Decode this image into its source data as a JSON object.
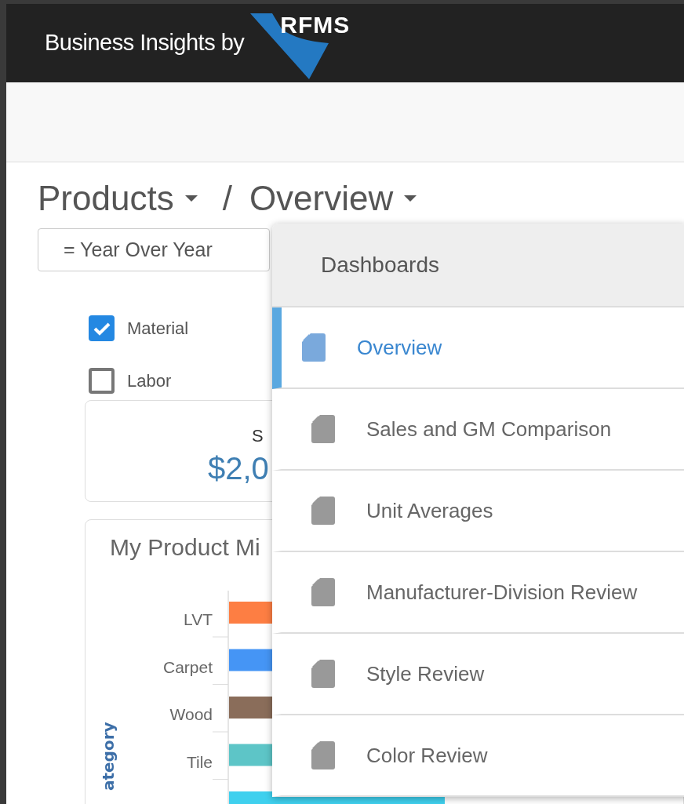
{
  "header": {
    "title": "Business Insights by",
    "logo_text": "RFMS"
  },
  "breadcrumb": [
    {
      "label": "Products"
    },
    {
      "label": "Overview"
    }
  ],
  "breadcrumb_separator": "/",
  "comparison_button": {
    "label": "= Year Over Year"
  },
  "filters": [
    {
      "label": "Material",
      "checked": true
    },
    {
      "label": "Labor",
      "checked": false
    }
  ],
  "kpi_card": {
    "label": "S",
    "value": "$2,0"
  },
  "product_mix": {
    "title": "My Product Mi",
    "axis_label": "ategory",
    "categories": [
      {
        "label": "LVT",
        "color": "#fd7e43"
      },
      {
        "label": "Carpet",
        "color": "#4595f5"
      },
      {
        "label": "Wood",
        "color": "#8a6d5a"
      },
      {
        "label": "Tile",
        "color": "#5dc5c7"
      },
      {
        "color": "#3fd0ee"
      }
    ]
  },
  "dashboards_menu": {
    "title": "Dashboards",
    "items": [
      {
        "label": "Overview",
        "selected": true
      },
      {
        "label": "Sales and GM Comparison",
        "selected": false
      },
      {
        "label": "Unit Averages",
        "selected": false
      },
      {
        "label": "Manufacturer-Division Review",
        "selected": false
      },
      {
        "label": "Style Review",
        "selected": false
      },
      {
        "label": "Color Review",
        "selected": false
      }
    ]
  }
}
